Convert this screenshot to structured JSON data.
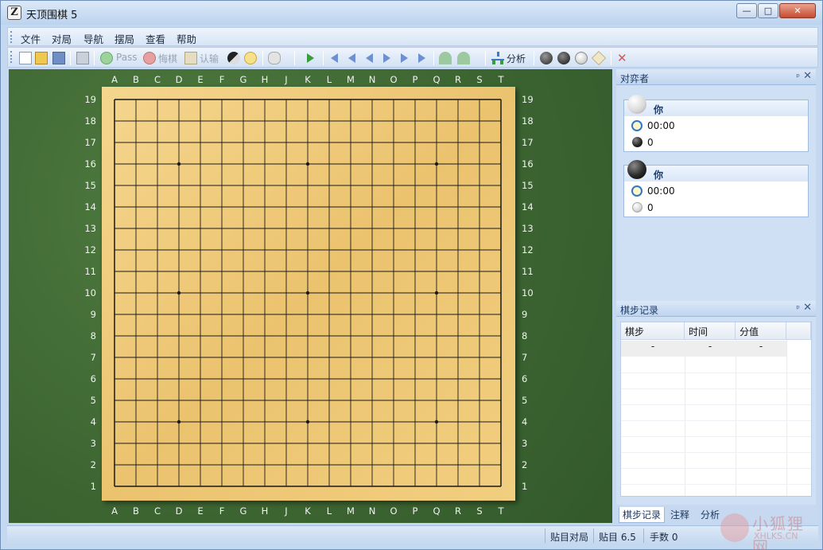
{
  "window": {
    "title": "天顶围棋 5",
    "app_icon_glyph": "Z",
    "minimize": "—",
    "maximize": "□",
    "close": "✕"
  },
  "menu": [
    "文件",
    "对局",
    "导航",
    "摆局",
    "查看",
    "帮助"
  ],
  "toolbar": {
    "pass_label": "Pass",
    "undo_label": "悔棋",
    "resign_label": "认输",
    "analyze_label": "分析",
    "icons": [
      "new-icon",
      "open-icon",
      "save-icon",
      "print-icon",
      "pass-icon",
      "undo-icon",
      "resign-icon",
      "score-icon",
      "hint-icon",
      "cup-icon",
      "play-icon",
      "first-icon",
      "prev10-icon",
      "prev-icon",
      "next-icon",
      "next10-icon",
      "last-icon",
      "rotate-left-icon",
      "rotate-right-icon",
      "analyze-icon",
      "stones-icon",
      "black-stone-icon",
      "white-stone-icon",
      "eraser-icon",
      "delete-icon"
    ]
  },
  "board": {
    "columns": [
      "A",
      "B",
      "C",
      "D",
      "E",
      "F",
      "G",
      "H",
      "J",
      "K",
      "L",
      "M",
      "N",
      "O",
      "P",
      "Q",
      "R",
      "S",
      "T"
    ],
    "rows": [
      "19",
      "18",
      "17",
      "16",
      "15",
      "14",
      "13",
      "12",
      "11",
      "10",
      "9",
      "8",
      "7",
      "6",
      "5",
      "4",
      "3",
      "2",
      "1"
    ],
    "star_points": [
      "D16",
      "K16",
      "Q16",
      "D10",
      "K10",
      "Q10",
      "D4",
      "K4",
      "Q4"
    ],
    "colors": {
      "felt": "#3c6431",
      "wood": "#efcb7a",
      "line": "#1a1a1a"
    }
  },
  "players_panel": {
    "title": "对弈者",
    "pin": "ᵖ",
    "close": "✕",
    "white": {
      "name": "你",
      "time": "00:00",
      "captures": "0"
    },
    "black": {
      "name": "你",
      "time": "00:00",
      "captures": "0"
    }
  },
  "moves_panel": {
    "title": "棋步记录",
    "pin": "ᵖ",
    "close": "✕",
    "columns": [
      "棋步",
      "时间",
      "分值"
    ],
    "rows": [
      [
        "-",
        "-",
        "-"
      ]
    ]
  },
  "tabs": [
    "棋步记录",
    "注释",
    "分析"
  ],
  "status": {
    "mode": "贴目对局",
    "komi": "贴目 6.5",
    "moves": "手数 0"
  },
  "watermark": {
    "text": "小狐狸网",
    "sub": "XHLKS.CN"
  }
}
